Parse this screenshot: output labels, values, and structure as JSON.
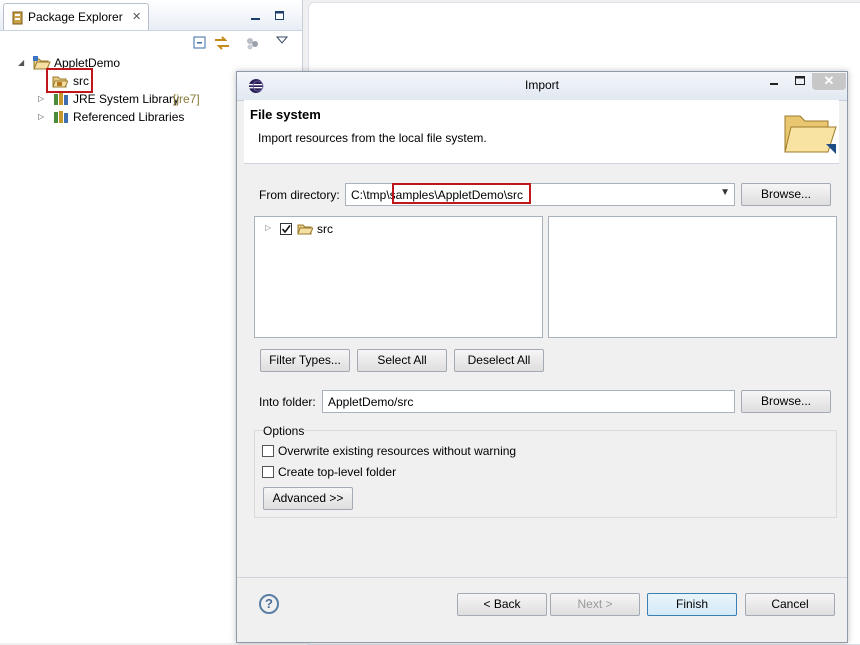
{
  "package_explorer": {
    "tab_title": "Package Explorer",
    "tree": {
      "project": "AppletDemo",
      "items": [
        {
          "label": "src"
        },
        {
          "label": "JRE System Library",
          "decoration": "[jre7]"
        },
        {
          "label": "Referenced Libraries"
        }
      ]
    }
  },
  "dialog": {
    "title": "Import",
    "banner": {
      "title": "File system",
      "description": "Import resources from the local file system."
    },
    "from_directory": {
      "label": "From directory:",
      "value": "C:\\tmp\\samples\\AppletDemo\\src",
      "browse": "Browse..."
    },
    "folder_tree": [
      {
        "label": "src",
        "checked": true
      }
    ],
    "buttons": {
      "filter_types": "Filter Types...",
      "select_all": "Select All",
      "deselect_all": "Deselect All"
    },
    "into_folder": {
      "label": "Into folder:",
      "value": "AppletDemo/src",
      "browse": "Browse..."
    },
    "options": {
      "legend": "Options",
      "overwrite": "Overwrite existing resources without warning",
      "create_top_level": "Create top-level folder",
      "advanced": "Advanced >>"
    },
    "footer": {
      "help": "?",
      "back": "< Back",
      "next": "Next >",
      "finish": "Finish",
      "cancel": "Cancel"
    }
  }
}
